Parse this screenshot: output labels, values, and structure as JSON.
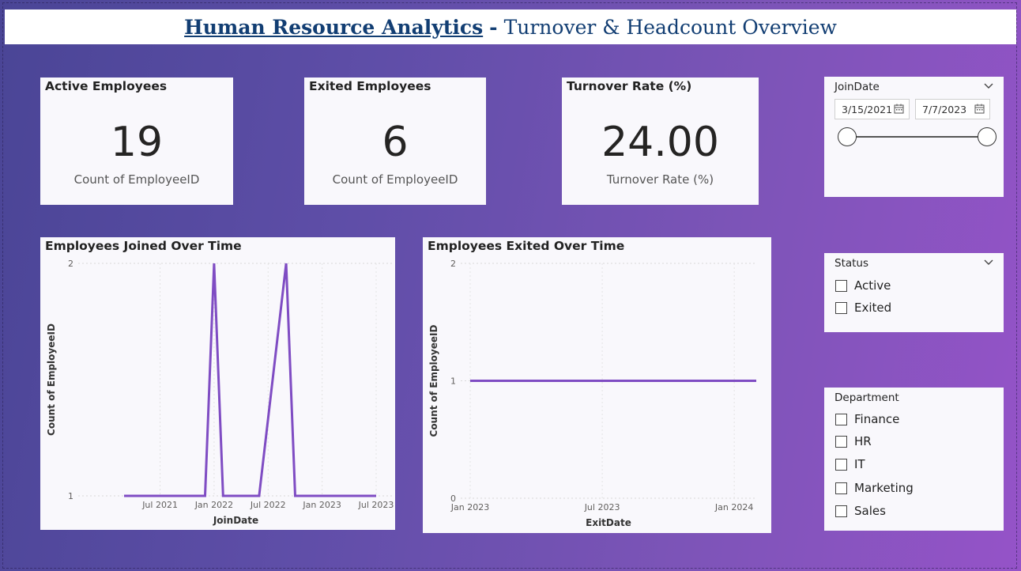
{
  "header": {
    "title_main": "Human Resource Analytics",
    "title_sep": "-",
    "title_sub": "Turnover & Headcount Overview",
    "color": "#123e73"
  },
  "kpis": [
    {
      "title": "Active Employees",
      "value": "19",
      "subtitle": "Count of EmployeeID"
    },
    {
      "title": "Exited Employees",
      "value": "6",
      "subtitle": "Count of EmployeeID"
    },
    {
      "title": "Turnover Rate (%)",
      "value": "24.00",
      "subtitle": "Turnover Rate (%)"
    }
  ],
  "slicers": {
    "joindate": {
      "title": "JoinDate",
      "start": "3/15/2021",
      "end": "7/7/2023",
      "range_fraction": [
        0,
        1
      ]
    },
    "status": {
      "title": "Status",
      "options": [
        "Active",
        "Exited"
      ]
    },
    "department": {
      "title": "Department",
      "options": [
        "Finance",
        "HR",
        "IT",
        "Marketing",
        "Sales"
      ]
    }
  },
  "chart_data": [
    {
      "type": "line",
      "title": "Employees Joined Over Time",
      "xlabel": "JoinDate",
      "ylabel": "Count of EmployeeID",
      "x_ticks": [
        "Jul 2021",
        "Jan 2022",
        "Jul 2022",
        "Jan 2023",
        "Jul 2023"
      ],
      "y_ticks": [
        "1",
        "2"
      ],
      "ylim": [
        1,
        2
      ],
      "x_range": [
        "2021-03",
        "2023-07"
      ],
      "series": [
        {
          "color": "#7f4cc3",
          "points": [
            [
              "2021-03",
              1
            ],
            [
              "2021-12",
              1
            ],
            [
              "2022-01",
              2
            ],
            [
              "2022-02",
              1
            ],
            [
              "2022-06",
              1
            ],
            [
              "2022-09",
              2
            ],
            [
              "2022-10",
              1
            ],
            [
              "2023-07",
              1
            ]
          ]
        }
      ],
      "grid": true
    },
    {
      "type": "line",
      "title": "Employees Exited Over Time",
      "xlabel": "ExitDate",
      "ylabel": "Count of EmployeeID",
      "x_ticks": [
        "Jan 2023",
        "Jul 2023",
        "Jan 2024"
      ],
      "y_ticks": [
        "0",
        "1",
        "2"
      ],
      "ylim": [
        0,
        2
      ],
      "x_range": [
        "2023-01",
        "2024-02"
      ],
      "series": [
        {
          "color": "#7f4cc3",
          "points": [
            [
              "2023-01",
              1
            ],
            [
              "2024-02",
              1
            ]
          ]
        }
      ],
      "grid": true
    }
  ]
}
